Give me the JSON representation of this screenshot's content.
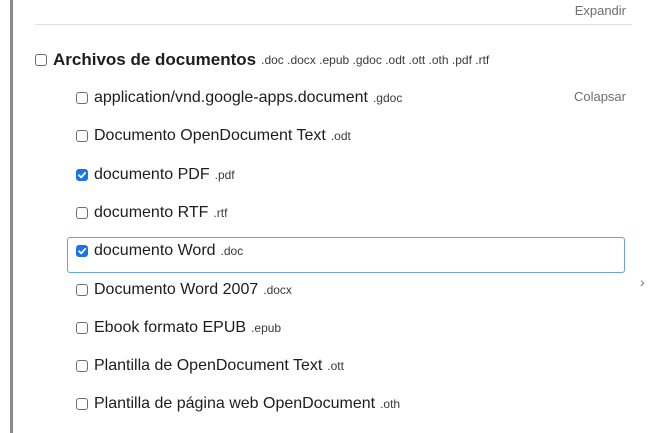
{
  "panel": {
    "expand_label": "Expandir",
    "collapse_label": "Colapsar"
  },
  "group": {
    "label": "Archivos de documentos",
    "extensions": ".doc .docx .epub .gdoc .odt .ott .oth .pdf .rtf",
    "checked": false
  },
  "items": [
    {
      "label": "application/vnd.google-apps.document",
      "ext": ".gdoc",
      "checked": false
    },
    {
      "label": "Documento OpenDocument Text",
      "ext": ".odt",
      "checked": false
    },
    {
      "label": "documento PDF",
      "ext": ".pdf",
      "checked": true
    },
    {
      "label": "documento RTF",
      "ext": ".rtf",
      "checked": false
    },
    {
      "label": "documento Word",
      "ext": ".doc",
      "checked": true
    },
    {
      "label": "Documento Word 2007",
      "ext": ".docx",
      "checked": false
    },
    {
      "label": "Ebook formato EPUB",
      "ext": ".epub",
      "checked": false
    },
    {
      "label": "Plantilla de OpenDocument Text",
      "ext": ".ott",
      "checked": false
    },
    {
      "label": "Plantilla de página web OpenDocument",
      "ext": ".oth",
      "checked": false
    }
  ],
  "colors": {
    "checked": "#1a73e8",
    "focus": "#6aa0e8"
  }
}
